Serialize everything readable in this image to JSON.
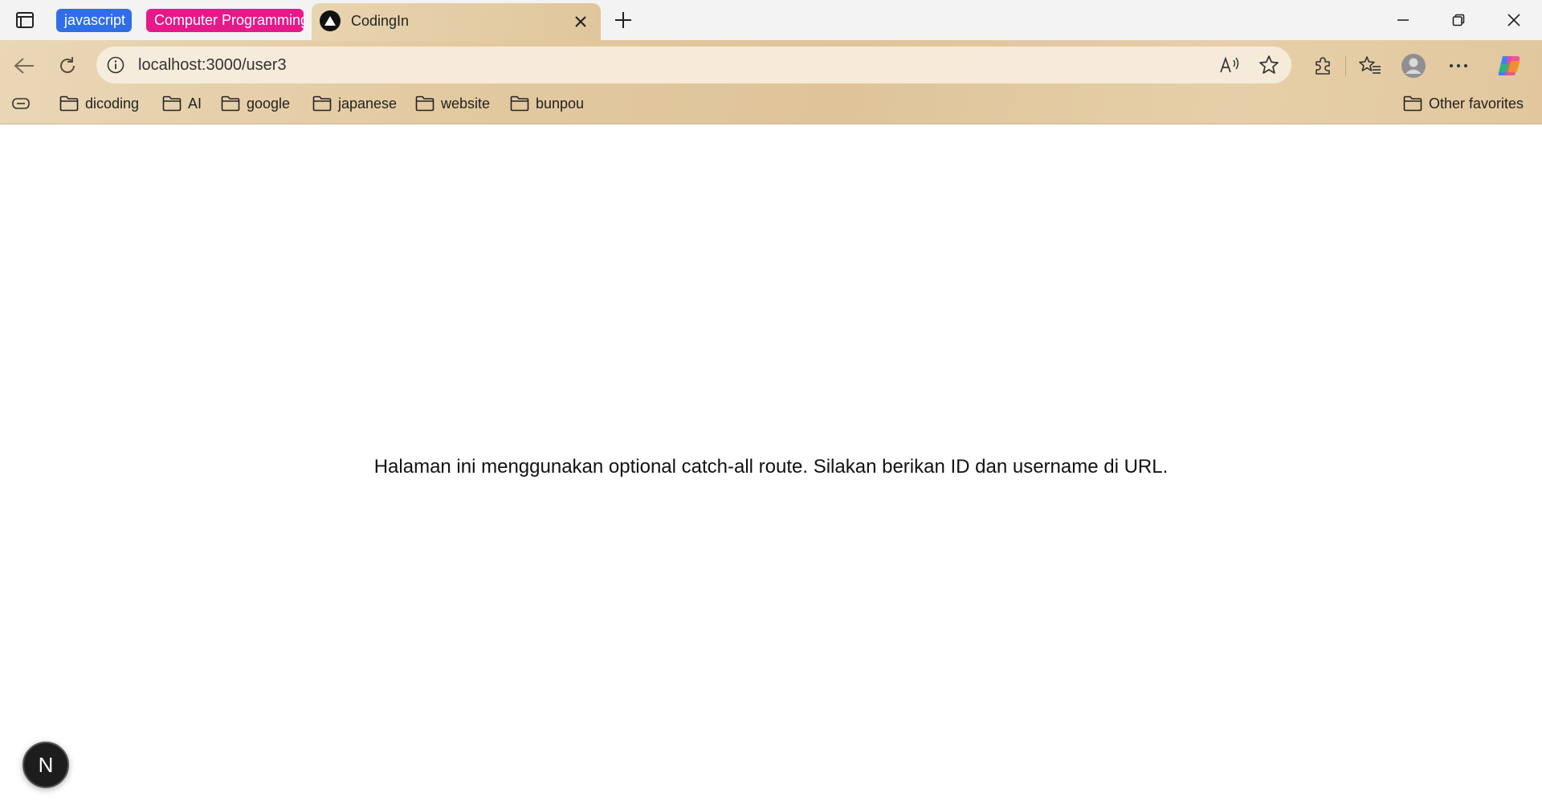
{
  "browser": {
    "tab_groups": [
      {
        "label": "javascript",
        "color": "#2f6ee6"
      },
      {
        "label": "Computer Programming",
        "color": "#e6198a"
      }
    ],
    "active_tab": {
      "title": "CodingIn"
    },
    "address_bar": {
      "url": "localhost:3000/user3"
    },
    "bookmarks": [
      {
        "label": "dicoding"
      },
      {
        "label": "AI"
      },
      {
        "label": "google"
      },
      {
        "label": "japanese"
      },
      {
        "label": "website"
      },
      {
        "label": "bunpou"
      }
    ],
    "other_favorites": "Other favorites"
  },
  "page": {
    "message": "Halaman ini menggunakan optional catch-all route. Silakan berikan ID dan username di URL.",
    "dev_badge": "N"
  }
}
